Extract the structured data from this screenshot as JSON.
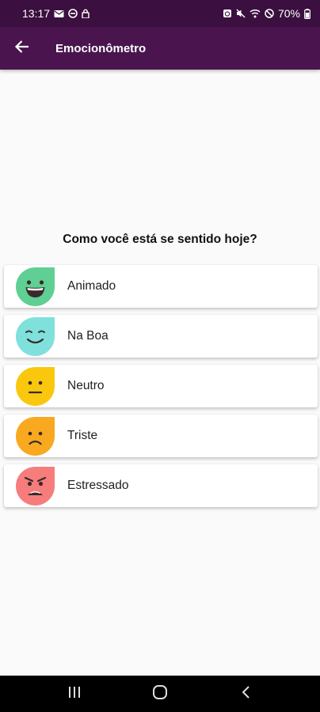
{
  "status_bar": {
    "time": "13:17",
    "battery": "70%",
    "left_icons": [
      "message-icon",
      "data-saver-icon",
      "lock-icon"
    ],
    "right_icons": [
      "alarm-icon",
      "mute-icon",
      "wifi-icon",
      "do-not-disturb-icon",
      "battery-icon"
    ]
  },
  "app_bar": {
    "title": "Emocionômetro",
    "back_icon": "arrow-left-icon"
  },
  "question": "Como você está se sentido hoje?",
  "moods": [
    {
      "label": "Animado",
      "color": "#5fcf93",
      "expression": "laugh"
    },
    {
      "label": "Na Boa",
      "color": "#7fe0dc",
      "expression": "smile"
    },
    {
      "label": "Neutro",
      "color": "#f9c80e",
      "expression": "neutral"
    },
    {
      "label": "Triste",
      "color": "#f8a91f",
      "expression": "sad"
    },
    {
      "label": "Estressado",
      "color": "#f77c7c",
      "expression": "angry"
    }
  ],
  "nav_bar": {
    "buttons": [
      "recent-apps-icon",
      "home-icon",
      "back-icon"
    ]
  },
  "colors": {
    "status_bar_bg": "#3b0f3f",
    "app_bar_bg": "#4a154e",
    "page_bg": "#fafafa"
  }
}
